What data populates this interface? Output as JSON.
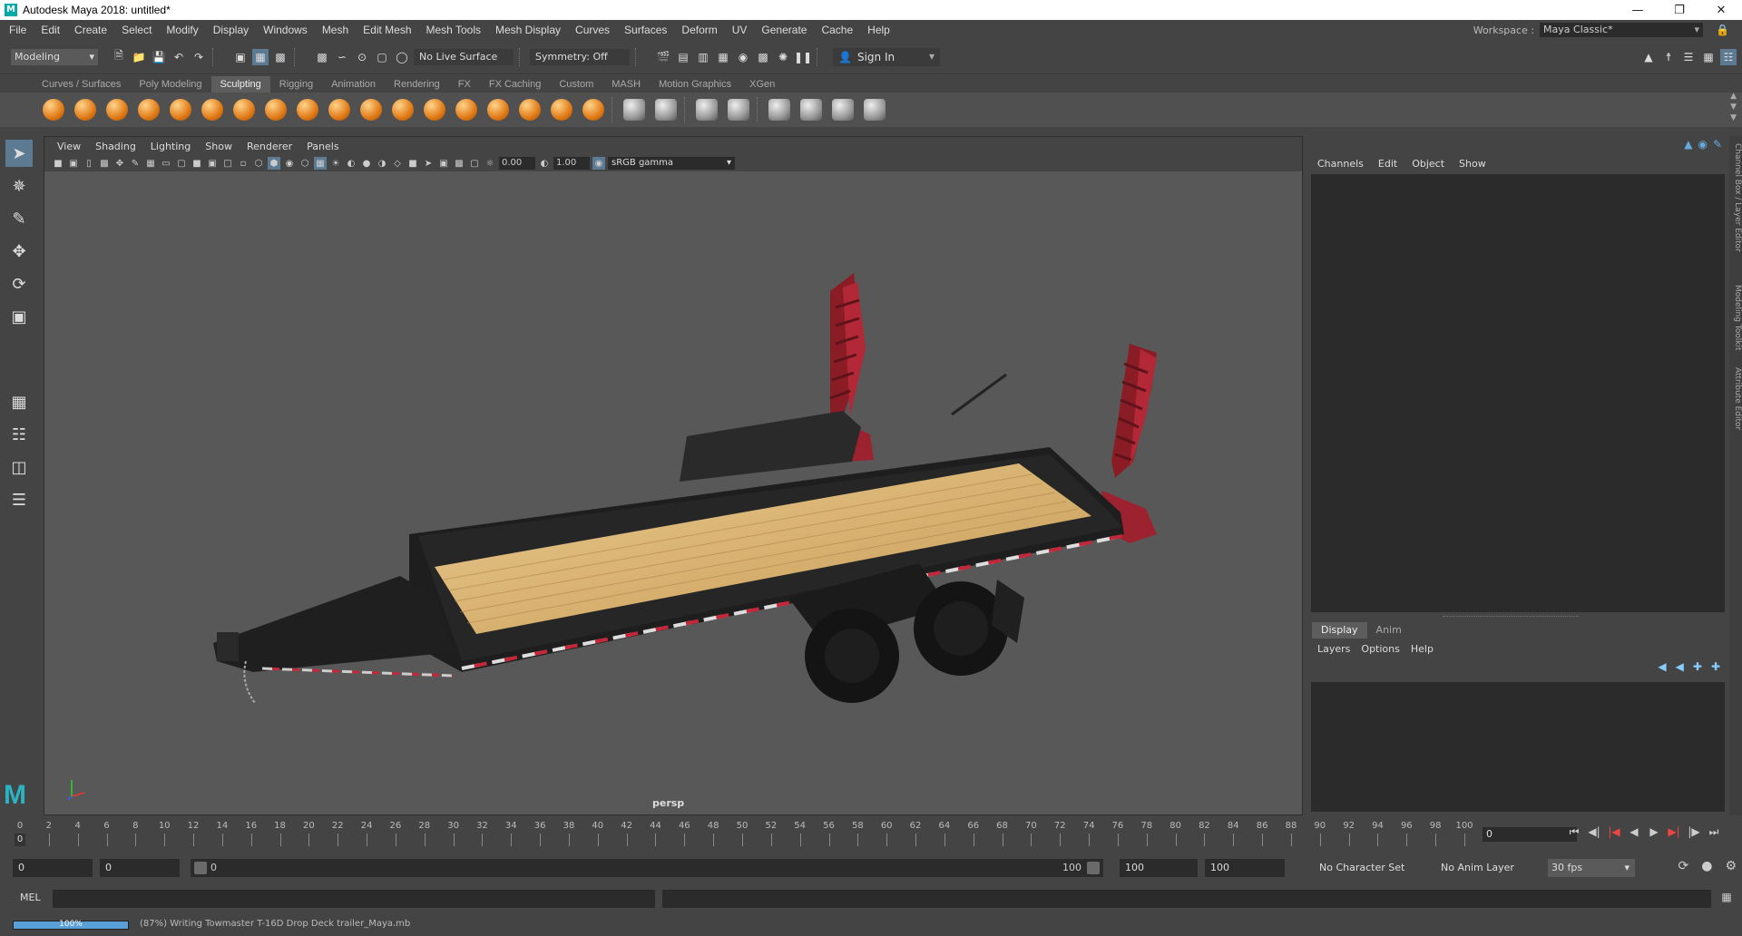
{
  "window": {
    "title": "Autodesk Maya 2018: untitled*",
    "app_icon": "M",
    "buttons": [
      "minimize-icon",
      "maximize-icon",
      "close-icon"
    ]
  },
  "menubar": {
    "items": [
      "File",
      "Edit",
      "Create",
      "Select",
      "Modify",
      "Display",
      "Windows",
      "Mesh",
      "Edit Mesh",
      "Mesh Tools",
      "Mesh Display",
      "Curves",
      "Surfaces",
      "Deform",
      "UV",
      "Generate",
      "Cache",
      "Help"
    ],
    "workspace_label": "Workspace :",
    "workspace_value": "Maya Classic*"
  },
  "statusline": {
    "mode": "Modeling",
    "live_surface": "No Live Surface",
    "symmetry": "Symmetry: Off",
    "sign_in": "Sign In"
  },
  "shelf": {
    "tabs": [
      "Curves / Surfaces",
      "Poly Modeling",
      "Sculpting",
      "Rigging",
      "Animation",
      "Rendering",
      "FX",
      "FX Caching",
      "Custom",
      "MASH",
      "Motion Graphics",
      "XGen"
    ],
    "active_tab": "Sculpting"
  },
  "viewport": {
    "menu": [
      "View",
      "Shading",
      "Lighting",
      "Show",
      "Renderer",
      "Panels"
    ],
    "exposure": "0.00",
    "gamma": "1.00",
    "color_space": "sRGB gamma",
    "camera": "persp"
  },
  "channelbox": {
    "menu": [
      "Channels",
      "Edit",
      "Object",
      "Show"
    ],
    "layer_tabs": [
      "Display",
      "Anim"
    ],
    "active_layer_tab": "Display",
    "layer_menu": [
      "Layers",
      "Options",
      "Help"
    ],
    "side_tabs": [
      "Channel Box / Layer Editor",
      "Modeling Toolkit",
      "Attribute Editor"
    ]
  },
  "timeslider": {
    "ticks": [
      0,
      2,
      4,
      6,
      8,
      10,
      12,
      14,
      16,
      18,
      20,
      22,
      24,
      26,
      28,
      30,
      32,
      34,
      36,
      38,
      40,
      42,
      44,
      46,
      48,
      50,
      52,
      54,
      56,
      58,
      60,
      62,
      64,
      66,
      68,
      70,
      72,
      74,
      76,
      78,
      80,
      82,
      84,
      86,
      88,
      90,
      92,
      94,
      96,
      98,
      100
    ],
    "current_frame": "0",
    "current_frame_marker": "0"
  },
  "rangeslider": {
    "start": "0",
    "anim_start": "0",
    "range_start": "0",
    "range_end": "100",
    "anim_end_a": "100",
    "anim_end_b": "100",
    "character_set": "No Character Set",
    "anim_layer": "No Anim Layer",
    "fps": "30 fps"
  },
  "cmdline": {
    "label": "MEL"
  },
  "helpline": {
    "progress": "100%",
    "progress_fraction": 1.0,
    "message": "(87%) Writing Towmaster T-16D Drop Deck trailer_Maya.mb"
  }
}
